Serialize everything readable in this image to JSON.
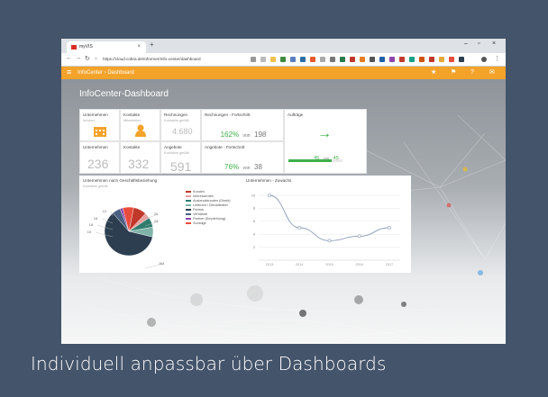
{
  "caption": "Individuell anpassbar über Dashboards",
  "browser": {
    "tab_title": "myVIS",
    "tab_close": "×",
    "new_tab": "+",
    "url": "https://cloud.cobra.de/Informer/Info-center/dashboard",
    "win_min": "–",
    "win_max": "▫",
    "win_close": "×"
  },
  "appbar": {
    "menu_icon": "≡",
    "breadcrumb": "InfoCenter  ›  Dashboard",
    "icons": [
      "star-icon",
      "flag-icon",
      "help-icon",
      "mail-icon"
    ]
  },
  "dashboard": {
    "title": "InfoCenter-Dashboard",
    "tiles": {
      "unternehmen1": {
        "label": "Unternehmen",
        "sub": "Infobox"
      },
      "kontakte1": {
        "label": "Kontakte",
        "sub": "Mitarbeiter"
      },
      "rechnungen": {
        "label": "Rechnungen",
        "sub": "Kontakte gefüllt",
        "value": "4.680"
      },
      "rechnungen_fortschritt": {
        "label": "Rechnungen - Fortschritt",
        "percent": "162%",
        "of_text": "von",
        "value": "198"
      },
      "auftraege": {
        "label": "Aufträge",
        "text": "45",
        "of_text": "von",
        "value": "45",
        "progress": 0.8
      },
      "unternehmen2": {
        "label": "Unternehmen",
        "value": "236"
      },
      "kontakte2": {
        "label": "Kontakte",
        "value": "332"
      },
      "angebote": {
        "label": "Angebote",
        "sub": "Kontakte gefüllt",
        "value": "591"
      },
      "angebote_fortschritt": {
        "label": "Angebote - Fortschritt",
        "percent": "76%",
        "of_text": "von",
        "value": "38"
      }
    },
    "pie_panel": {
      "title": "Unternehmen nach Geschäftsbeziehung",
      "sub": "Kontakte gefüllt",
      "labels": [
        "10",
        "18",
        "18",
        "15",
        "20",
        "24",
        "164"
      ],
      "legend": [
        {
          "name": "Kunden",
          "color": "#c0392b"
        },
        {
          "name": "Interessenten",
          "color": "#e8a0a0"
        },
        {
          "name": "Auslandskunden (Direkt)",
          "color": "#2e7d6e"
        },
        {
          "name": "Lieferant / Dienstleister",
          "color": "#7fb3a8"
        },
        {
          "name": "Partner",
          "color": "#2c3e50"
        },
        {
          "name": "Verbände",
          "color": "#4a6080"
        },
        {
          "name": "Partner (Empfehlung)",
          "color": "#8e44ad"
        },
        {
          "name": "Sonstige",
          "color": "#e74c3c"
        }
      ]
    },
    "line_panel": {
      "title": "Unternehmen - Zuwachs",
      "y_ticks": [
        "10",
        "8",
        "6",
        "4",
        "2"
      ],
      "x_ticks": [
        "2013",
        "2014",
        "2015",
        "2016",
        "2017"
      ]
    }
  },
  "chart_data": [
    {
      "type": "pie",
      "title": "Unternehmen nach Geschäftsbeziehung",
      "categories": [
        "Kunden",
        "Interessenten",
        "Auslandskunden (Direkt)",
        "Lieferant / Dienstleister",
        "Partner",
        "Verbände",
        "Partner (Empfehlung)",
        "Sonstige"
      ],
      "values": [
        24,
        10,
        18,
        18,
        164,
        15,
        5,
        20
      ]
    },
    {
      "type": "line",
      "title": "Unternehmen - Zuwachs",
      "x": [
        "2013",
        "2014",
        "2015",
        "2016",
        "2017"
      ],
      "values": [
        10,
        5,
        3,
        3.7,
        5
      ],
      "ylim": [
        0,
        10
      ]
    }
  ]
}
